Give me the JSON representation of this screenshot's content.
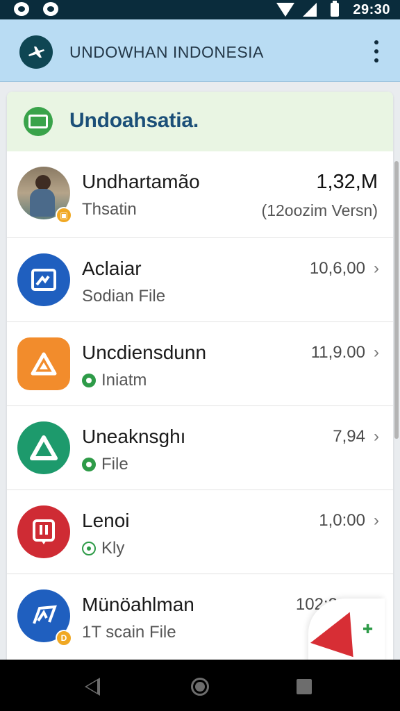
{
  "status_bar": {
    "time": "29:30"
  },
  "app_bar": {
    "title": "UNDOWHAN INDONESIA"
  },
  "card": {
    "title": "Undoahsatia."
  },
  "items": [
    {
      "title": "Undhartamão",
      "subtitle": "Thsatin",
      "value": "1,32,M",
      "detail": "(12oozim Versn)",
      "icon": "person-photo-avatar",
      "badge": "",
      "color": "#8a7a64"
    },
    {
      "title": "Aclaiar",
      "subtitle": "Sodian File",
      "value": "10,6,00",
      "icon": "image-edit-icon",
      "color": "#1f5fbf"
    },
    {
      "title": "Uncdiensdunn",
      "subtitle": "Iniatm",
      "value": "11,9.00",
      "icon": "drive-triangle-icon",
      "color": "#f28c2c"
    },
    {
      "title": "Uneaknsghı",
      "subtitle": "File",
      "value": "7,94",
      "icon": "triangle-app-icon",
      "color": "#1d9a6c"
    },
    {
      "title": "Lenoi",
      "subtitle": "Kly",
      "value": "1,0:00",
      "icon": "presentation-icon",
      "color": "#cf2b34"
    },
    {
      "title": "Münöahlman",
      "subtitle": "1T scain File",
      "value": "102:2ooo",
      "icon": "music-note-icon",
      "badge": "D",
      "color": "#1f5fbf"
    }
  ]
}
